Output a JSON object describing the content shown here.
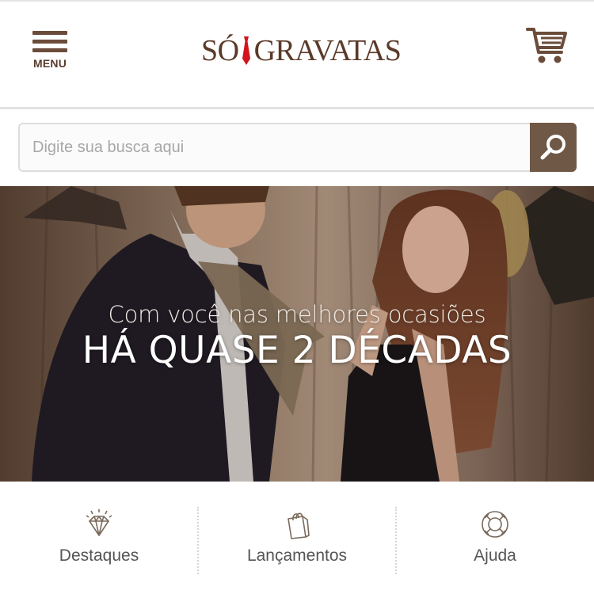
{
  "header": {
    "menu_label": "MENU",
    "logo_left": "SÓ",
    "logo_right": "GRAVATAS",
    "menu_icon": "hamburger-icon",
    "cart_icon": "shopping-cart-icon",
    "brand_color": "#5b3a29",
    "tie_color": "#d0151c"
  },
  "search": {
    "placeholder": "Digite sua busca aqui",
    "value": "",
    "button_icon": "search-icon",
    "button_color": "#6f5846"
  },
  "banner": {
    "subtitle": "Com você nas melhores ocasiões",
    "headline": "HÁ QUASE 2 DÉCADAS"
  },
  "bottom_nav": {
    "items": [
      {
        "label": "Destaques",
        "icon": "diamond-icon"
      },
      {
        "label": "Lançamentos",
        "icon": "shopping-bag-icon"
      },
      {
        "label": "Ajuda",
        "icon": "lifebuoy-icon"
      }
    ]
  }
}
